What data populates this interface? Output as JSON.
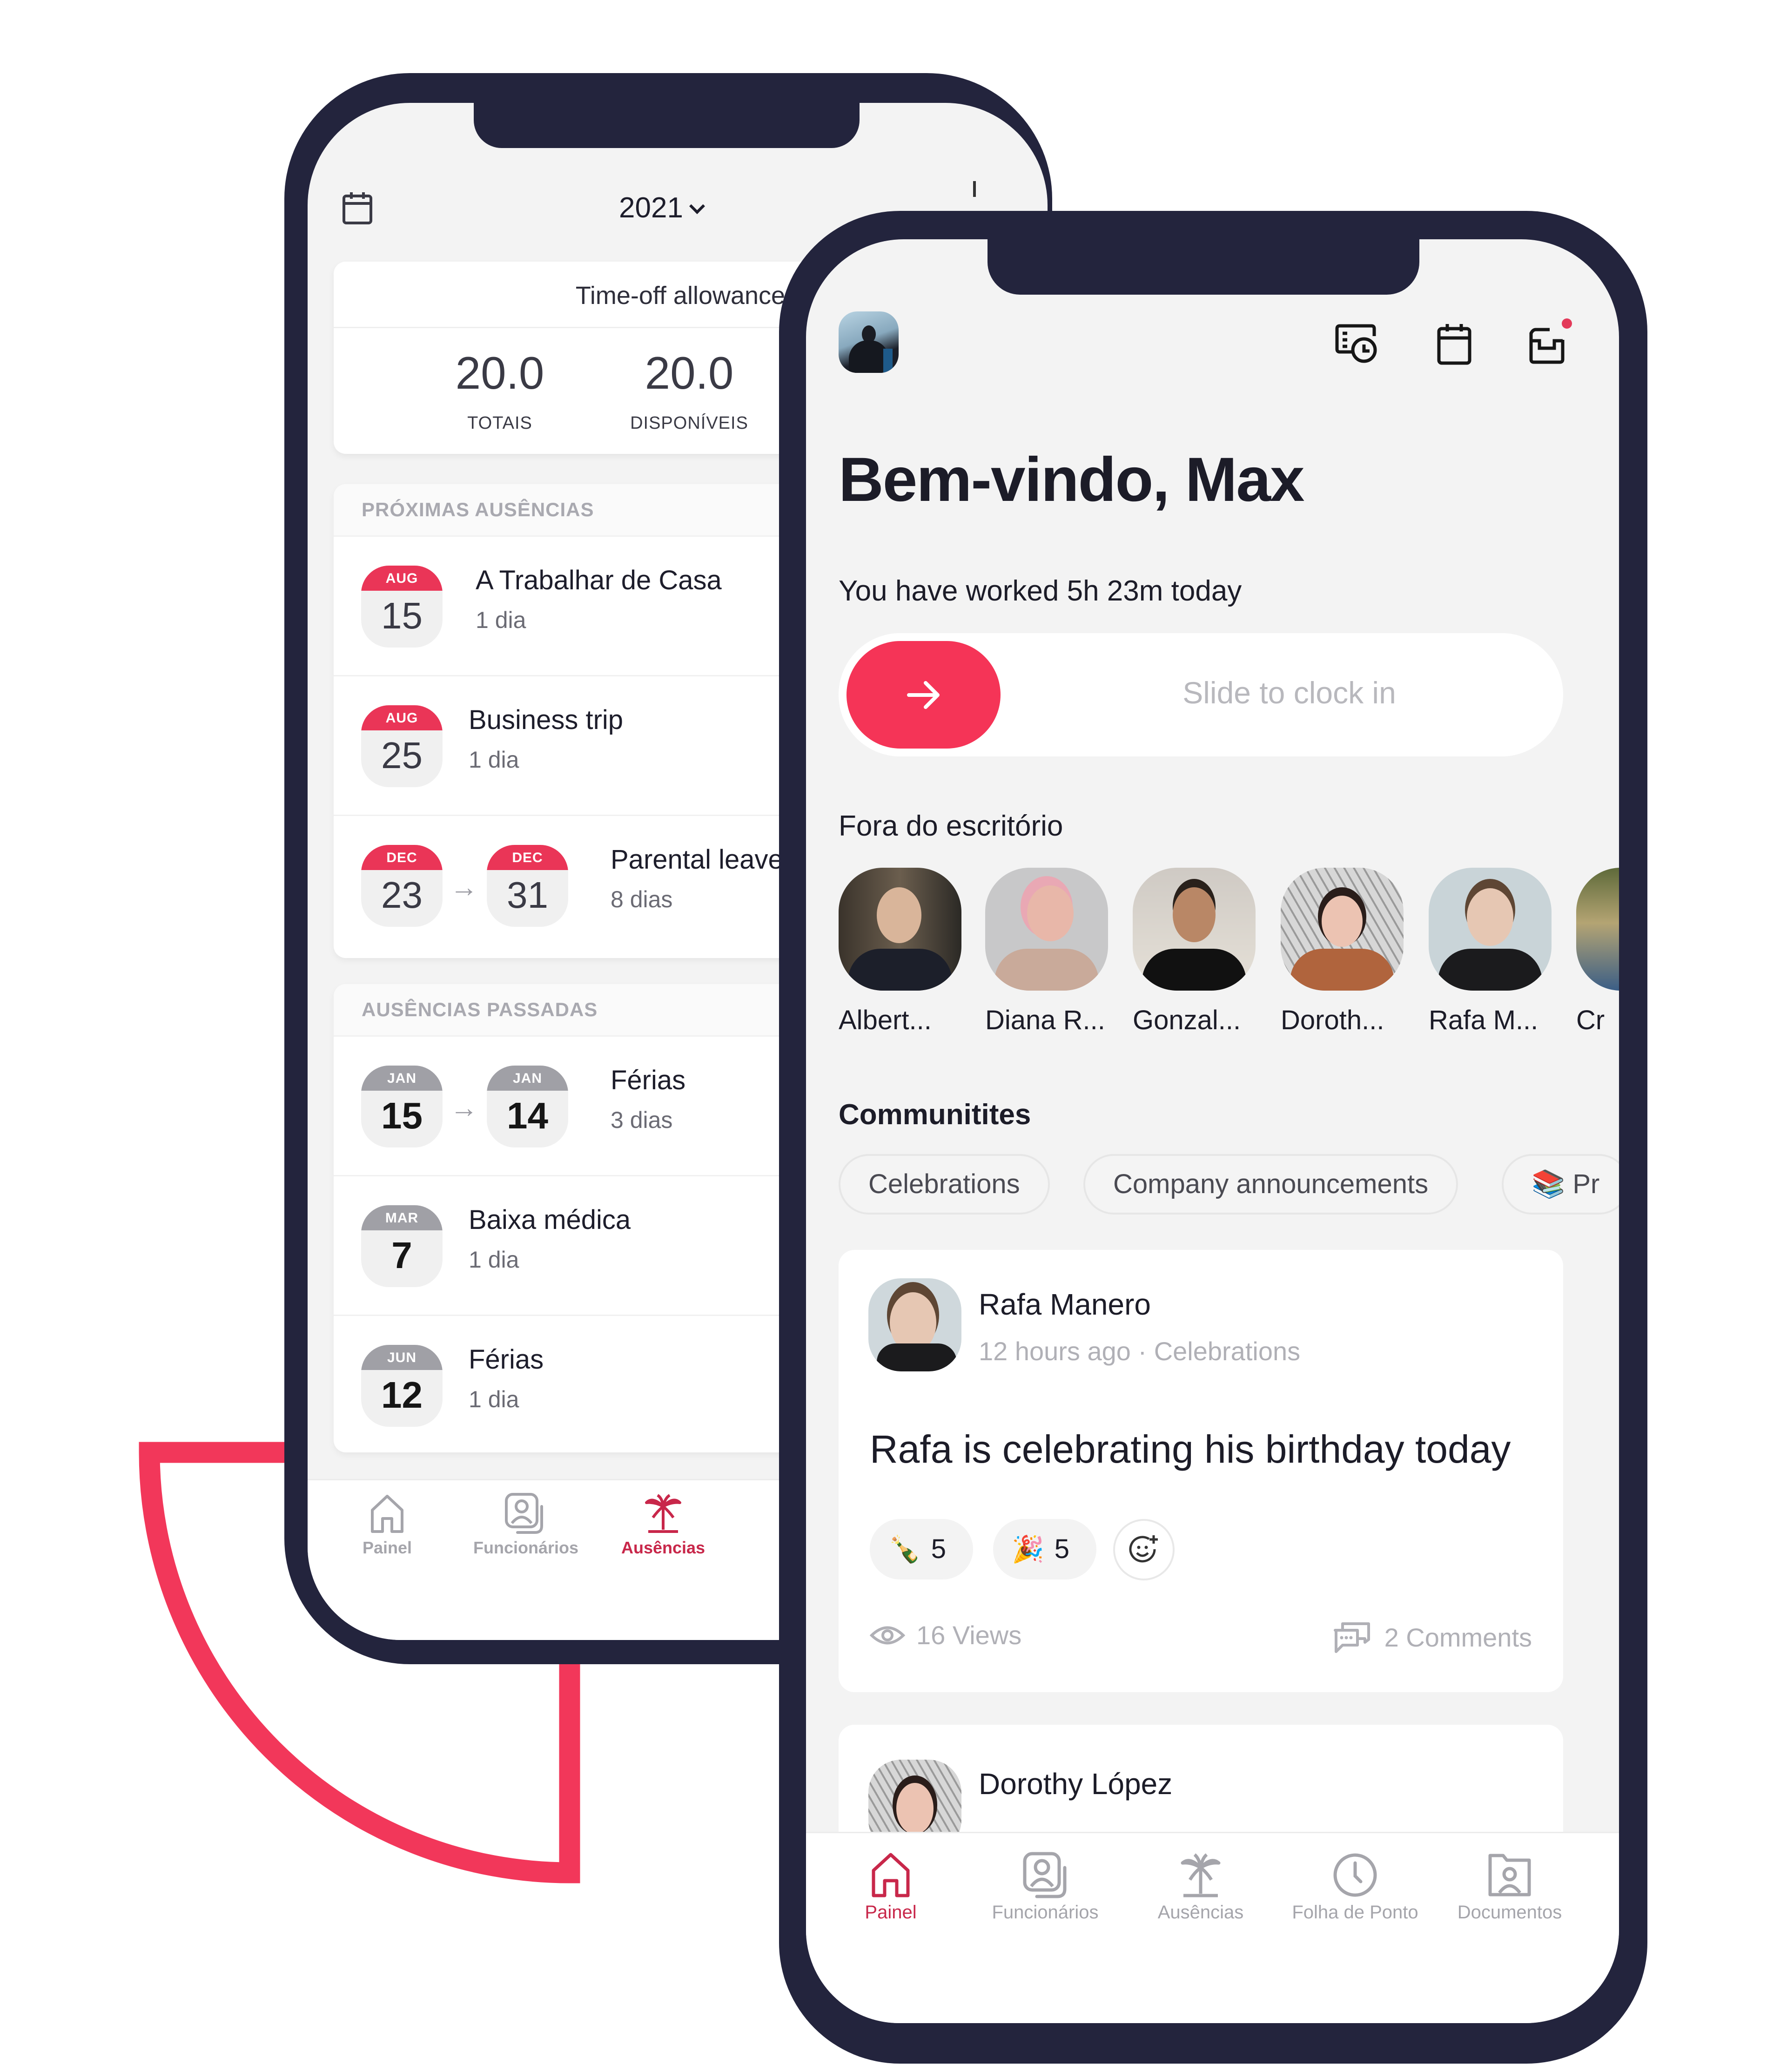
{
  "back_phone": {
    "header": {
      "year": "2021"
    },
    "allowance": {
      "title": "Time-off allowance",
      "stats": [
        {
          "value": "20.0",
          "label": "TOTAIS"
        },
        {
          "value": "20.0",
          "label": "DISPONÍVEIS"
        }
      ]
    },
    "upcoming": {
      "title": "PRÓXIMAS AUSÊNCIAS",
      "items": [
        {
          "start": {
            "month": "AUG",
            "day": "15"
          },
          "title": "A Trabalhar de Casa",
          "duration": "1 dia"
        },
        {
          "start": {
            "month": "AUG",
            "day": "25"
          },
          "title": "Business trip",
          "duration": "1 dia"
        },
        {
          "start": {
            "month": "DEC",
            "day": "23"
          },
          "end": {
            "month": "DEC",
            "day": "31"
          },
          "title": "Parental leave",
          "duration": "8 dias"
        }
      ]
    },
    "past": {
      "title": "AUSÊNCIAS PASSADAS",
      "items": [
        {
          "start": {
            "month": "JAN",
            "day": "15"
          },
          "end": {
            "month": "JAN",
            "day": "14"
          },
          "title": "Férias",
          "duration": "3 dias"
        },
        {
          "start": {
            "month": "MAR",
            "day": "7"
          },
          "title": "Baixa médica",
          "duration": "1 dia"
        },
        {
          "start": {
            "month": "JUN",
            "day": "12"
          },
          "title": "Férias",
          "duration": "1 dia"
        }
      ]
    },
    "tabbar": [
      {
        "label": "Painel",
        "icon": "home-icon",
        "active": false
      },
      {
        "label": "Funcionários",
        "icon": "employees-icon",
        "active": false
      },
      {
        "label": "Ausências",
        "icon": "palm-tree-icon",
        "active": true
      }
    ]
  },
  "front_phone": {
    "header": {
      "icons": [
        "timesheet-icon",
        "calendar-icon",
        "inbox-icon"
      ],
      "inbox_has_notification": true
    },
    "welcome": "Bem-vindo, Max",
    "worked_today": "You have worked 5h 23m today",
    "clock_slider": {
      "label": "Slide to clock in"
    },
    "out_of_office": {
      "title": "Fora do escritório",
      "people": [
        "Albert...",
        "Diana R...",
        "Gonzal...",
        "Doroth...",
        "Rafa M...",
        "Cr"
      ]
    },
    "communities": {
      "title": "Communitites",
      "chips": [
        {
          "label": "Celebrations",
          "emoji": ""
        },
        {
          "label": "Company announcements",
          "emoji": ""
        },
        {
          "label": "Pr",
          "emoji": "📚"
        }
      ]
    },
    "posts": [
      {
        "author": "Rafa Manero",
        "time": "12 hours ago",
        "community": "Celebrations",
        "body": "Rafa is celebrating his birthday today",
        "reactions": [
          {
            "emoji": "🍾",
            "count": "5"
          },
          {
            "emoji": "🎉",
            "count": "5"
          }
        ],
        "views": "16 Views",
        "comments": "2 Comments"
      },
      {
        "author": "Dorothy López"
      }
    ],
    "tabbar": [
      {
        "label": "Painel",
        "icon": "home-icon",
        "active": true
      },
      {
        "label": "Funcionários",
        "icon": "employees-icon",
        "active": false
      },
      {
        "label": "Ausências",
        "icon": "palm-tree-icon",
        "active": false
      },
      {
        "label": "Folha de Ponto",
        "icon": "clock-icon",
        "active": false
      },
      {
        "label": "Documentos",
        "icon": "documents-icon",
        "active": false
      }
    ]
  },
  "colors": {
    "brand": "#f53457",
    "frame": "#23243d",
    "active_tab": "#c8274a",
    "past_badge": "#a0a0a6"
  }
}
